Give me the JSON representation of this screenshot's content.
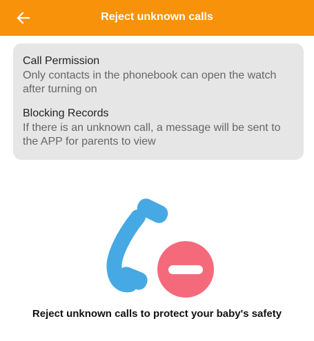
{
  "header": {
    "title": "Reject unknown calls",
    "back_icon": "arrow-left-icon",
    "background_color": "#f7920a"
  },
  "info": {
    "sections": [
      {
        "title": "Call Permission",
        "description": "Only contacts in the phonebook can open the watch after turning on"
      },
      {
        "title": "Blocking Records",
        "description": "If there is an unknown call, a message will be sent to the APP for parents to view"
      }
    ]
  },
  "illustration": {
    "phone_icon": "phone-handset-icon",
    "block_icon": "no-entry-icon",
    "phone_color": "#46a9e4",
    "block_color": "#f56a7b"
  },
  "footer": {
    "slogan": "Reject unknown calls to protect your baby's safety"
  }
}
